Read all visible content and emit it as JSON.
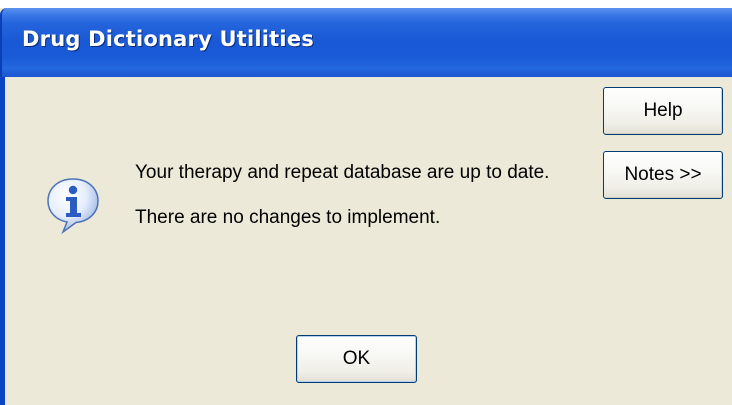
{
  "window": {
    "title": "Drug Dictionary Utilities"
  },
  "message": {
    "line1": "Your therapy and repeat database are up to date.",
    "line2": "There are no changes to implement."
  },
  "buttons": {
    "help": "Help",
    "notes": "Notes >>",
    "ok": "OK"
  },
  "icon": {
    "name": "information-icon",
    "glyph": "i",
    "color": "#2a5bc2"
  },
  "colors": {
    "titlebar": "#1958d6",
    "dialog_bg": "#ece9d8",
    "button_border": "#003c74"
  }
}
